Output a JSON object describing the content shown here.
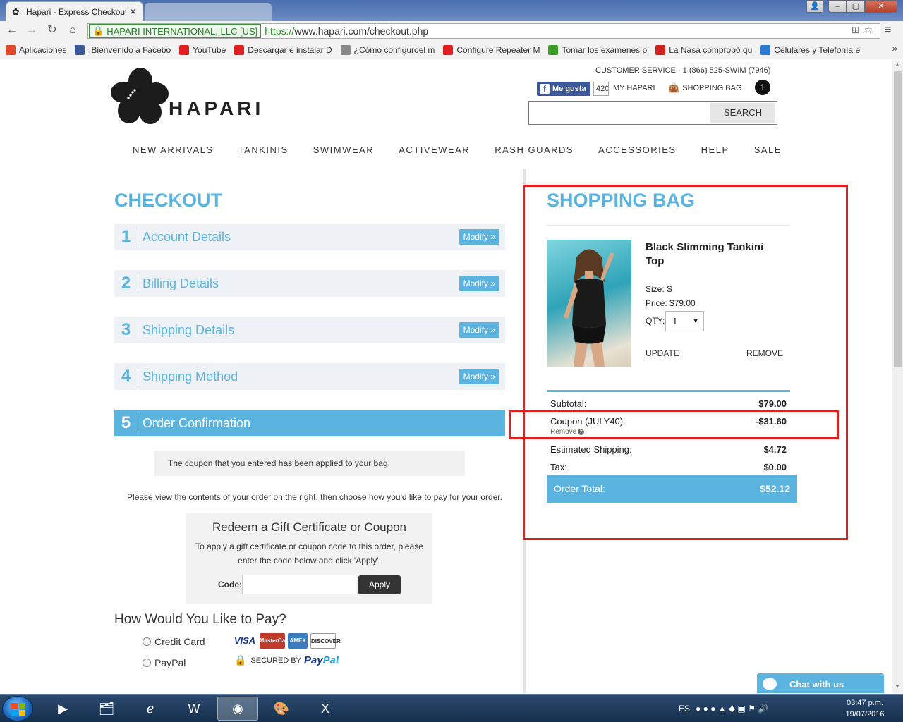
{
  "browser": {
    "tab_title": "Hapari - Express Checkout",
    "site_identity": "HAPARI INTERNATIONAL, LLC [US]",
    "url_proto": "https://",
    "url_rest": "www.hapari.com/checkout.php"
  },
  "bookmarks": [
    {
      "label": "Aplicaciones",
      "color": "#e04a2a"
    },
    {
      "label": "¡Bienvenido a Facebo",
      "color": "#3b5998"
    },
    {
      "label": "YouTube",
      "color": "#e02020"
    },
    {
      "label": "Descargar e instalar D",
      "color": "#e02020"
    },
    {
      "label": "¿Cómo configuroel m",
      "color": "#888888"
    },
    {
      "label": "Configure Repeater M",
      "color": "#e02020"
    },
    {
      "label": "Tomar los exámenes p",
      "color": "#3aa02a"
    },
    {
      "label": "La Nasa comprobó qu",
      "color": "#d02020"
    },
    {
      "label": "Celulares y Telefonía e",
      "color": "#2a7ad0"
    }
  ],
  "header": {
    "customer_service": "CUSTOMER SERVICE · 1 (866) 525-SWIM (7946)",
    "fb_like": "Me gusta",
    "fb_count": "420",
    "my_hapari": "MY HAPARI",
    "shopping_bag": "SHOPPING BAG",
    "bag_count": "1",
    "search_button": "SEARCH",
    "logo_text": "HAPARI"
  },
  "nav": [
    "NEW ARRIVALS",
    "TANKINIS",
    "SWIMWEAR",
    "ACTIVEWEAR",
    "RASH GUARDS",
    "ACCESSORIES",
    "HELP",
    "SALE"
  ],
  "checkout": {
    "title": "CHECKOUT",
    "steps": [
      {
        "num": "1",
        "label": "Account Details",
        "modify": "Modify »"
      },
      {
        "num": "2",
        "label": "Billing Details",
        "modify": "Modify »"
      },
      {
        "num": "3",
        "label": "Shipping Details",
        "modify": "Modify »"
      },
      {
        "num": "4",
        "label": "Shipping Method",
        "modify": "Modify »"
      },
      {
        "num": "5",
        "label": "Order Confirmation"
      }
    ],
    "notice": "The coupon that you entered has been applied to your bag.",
    "instructions": "Please view the contents of your order on the right, then choose how you'd like to pay for your order.",
    "gift": {
      "heading": "Redeem a Gift Certificate or Coupon",
      "text": "To apply a gift certificate or coupon code to this order, please enter the code below and click 'Apply'.",
      "code_label": "Code:",
      "code_value": "",
      "apply": "Apply"
    },
    "pay": {
      "title": "How Would You Like to Pay?",
      "credit_card": "Credit Card",
      "paypal": "PayPal",
      "cards": [
        "VISA",
        "MasterCard",
        "AMEX",
        "DISCOVER"
      ],
      "secured_by": "SECURED BY",
      "paypal_logo_a": "Pay",
      "paypal_logo_b": "Pal"
    }
  },
  "bag": {
    "title": "SHOPPING BAG",
    "product_name": "Black Slimming Tankini Top",
    "size": "Size: S",
    "price": "Price: $79.00",
    "qty_label": "QTY:",
    "qty_value": "1",
    "update": "UPDATE",
    "remove": "REMOVE",
    "subtotal_label": "Subtotal:",
    "subtotal_value": "$79.00",
    "coupon_label": "Coupon (JULY40):",
    "coupon_value": "-$31.60",
    "coupon_remove": "Remove",
    "shipping_label": "Estimated Shipping:",
    "shipping_value": "$4.72",
    "tax_label": "Tax:",
    "tax_value": "$0.00",
    "total_label": "Order Total:",
    "total_value": "$52.12"
  },
  "chat": {
    "label": "Chat with us"
  },
  "taskbar": {
    "lang": "ES",
    "time": "03:47 p.m.",
    "date": "19/07/2016"
  }
}
